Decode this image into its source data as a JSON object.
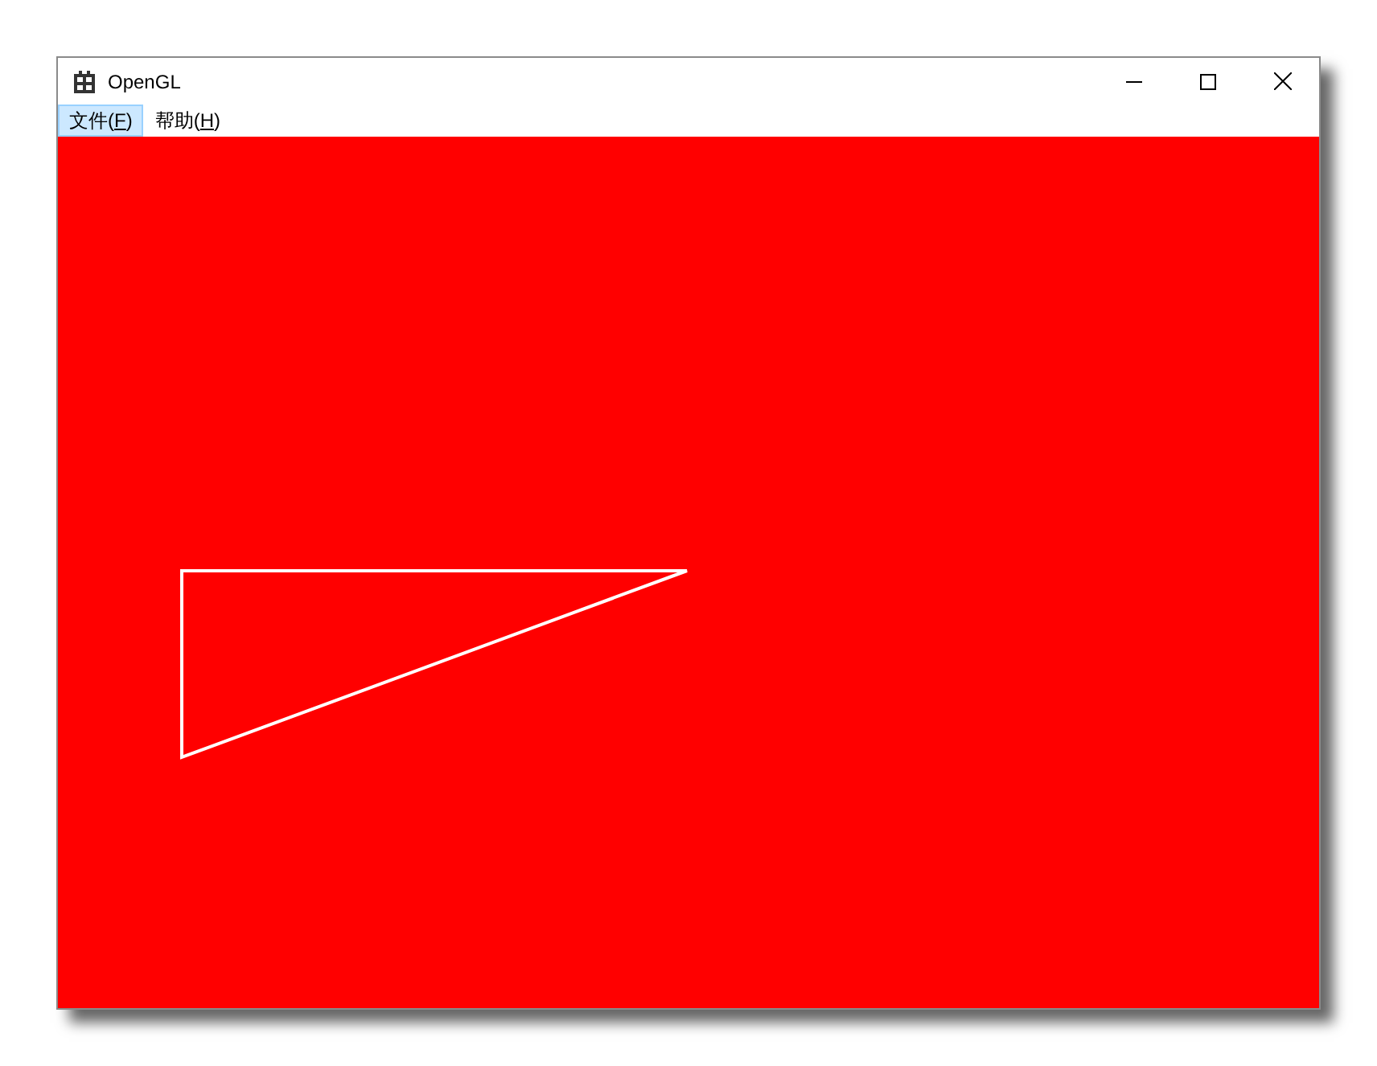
{
  "window": {
    "title": "OpenGL"
  },
  "menu": [
    {
      "before": "文件(",
      "accelerator": "F",
      "after": ")",
      "selected": true
    },
    {
      "before": "帮助(",
      "accelerator": "H",
      "after": ")",
      "selected": false
    }
  ]
}
